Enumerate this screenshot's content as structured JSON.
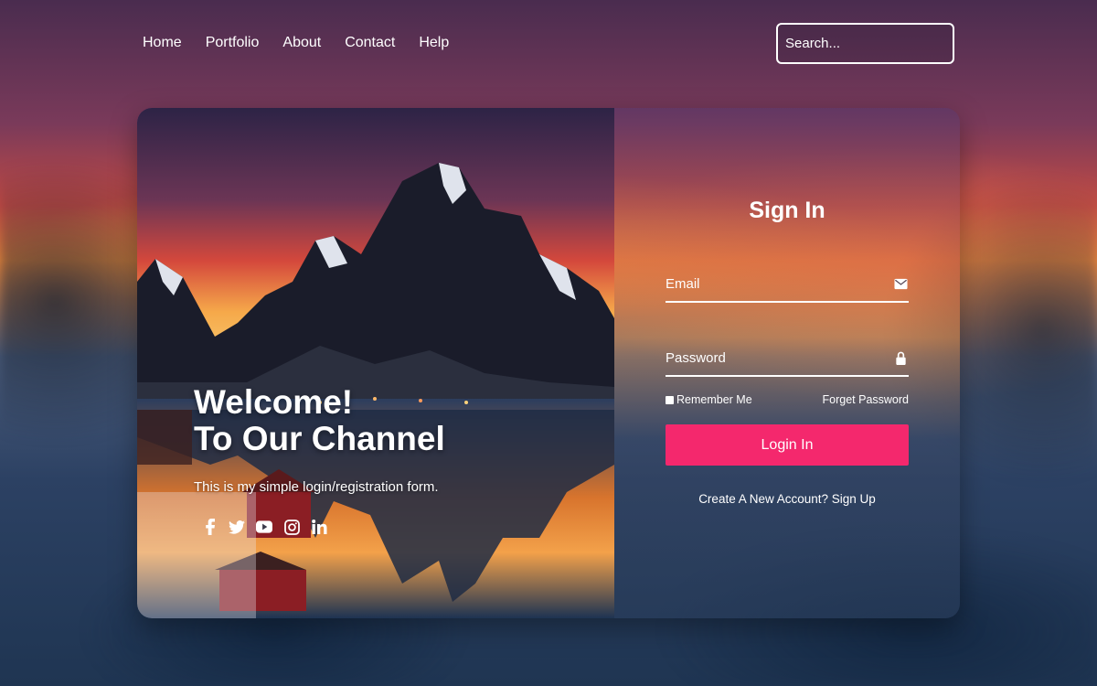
{
  "nav": {
    "items": [
      "Home",
      "Portfolio",
      "About",
      "Contact",
      "Help"
    ],
    "search_placeholder": "Search..."
  },
  "hero": {
    "title_line1": "Welcome!",
    "title_line2": "To Our Channel",
    "tagline": "This is my simple login/registration form.",
    "social_icons": [
      "facebook-icon",
      "twitter-icon",
      "youtube-icon",
      "instagram-icon",
      "linkedin-icon"
    ]
  },
  "form": {
    "title": "Sign In",
    "email_placeholder": "Email",
    "password_placeholder": "Password",
    "remember_label": "Remember Me",
    "forgot_label": "Forget Password",
    "login_label": "Login In",
    "signup_label": "Create A New Account? Sign Up",
    "email_icon": "envelope-icon",
    "password_icon": "lock-icon"
  },
  "colors": {
    "accent": "#f4286d",
    "text": "#ffffff"
  }
}
